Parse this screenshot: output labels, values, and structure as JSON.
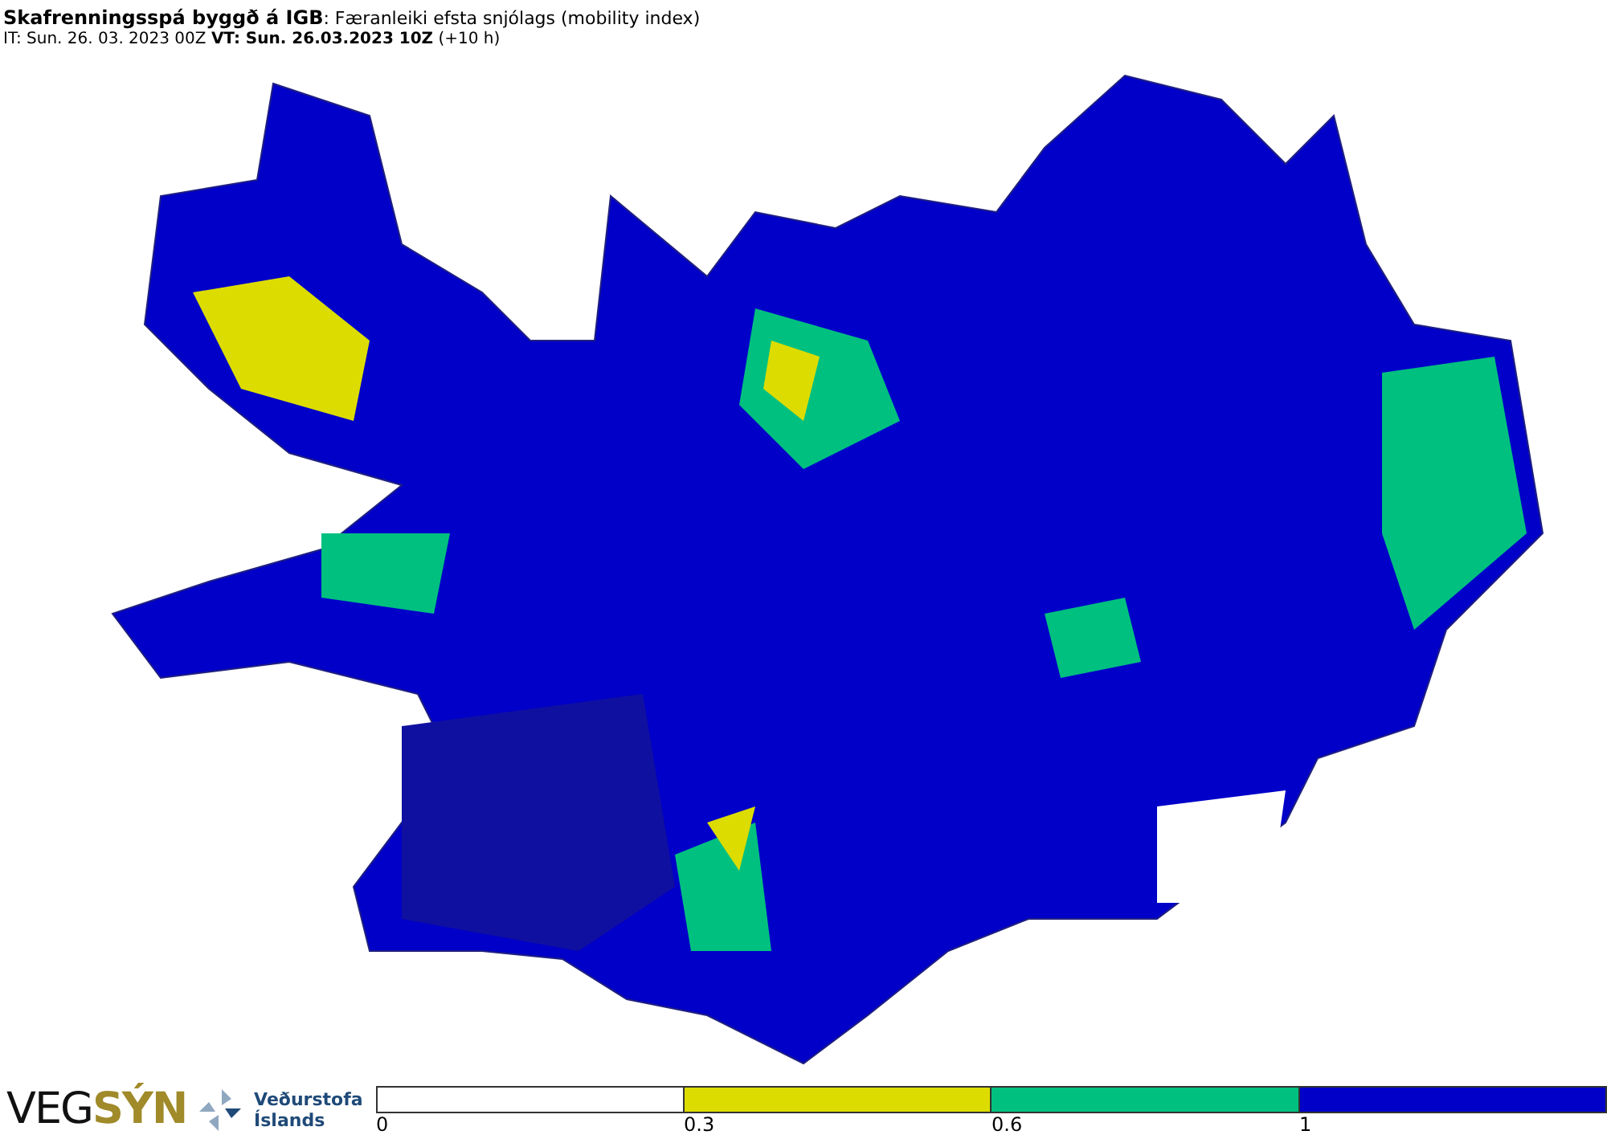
{
  "header": {
    "title": "**Skafrenningsspá byggð á IGB**: Færanleiki efsta snjólags (mobility index)",
    "times": "IT: Sun. 26. 03. 2023 00Z **VT: Sun. 26.03.2023 10Z** (+10 h)"
  },
  "footer": {
    "logo": "VEG**SÝN**",
    "agency": [
      "Veðurstofa",
      "Íslands"
    ],
    "legend": [
      {
        "label": "0",
        "color": "#ffffff"
      },
      {
        "label": "0.3",
        "color": "#dcdc00"
      },
      {
        "label": "0.6",
        "color": "#00c080"
      },
      {
        "label": "1",
        "color": "#0000c8"
      }
    ]
  }
}
